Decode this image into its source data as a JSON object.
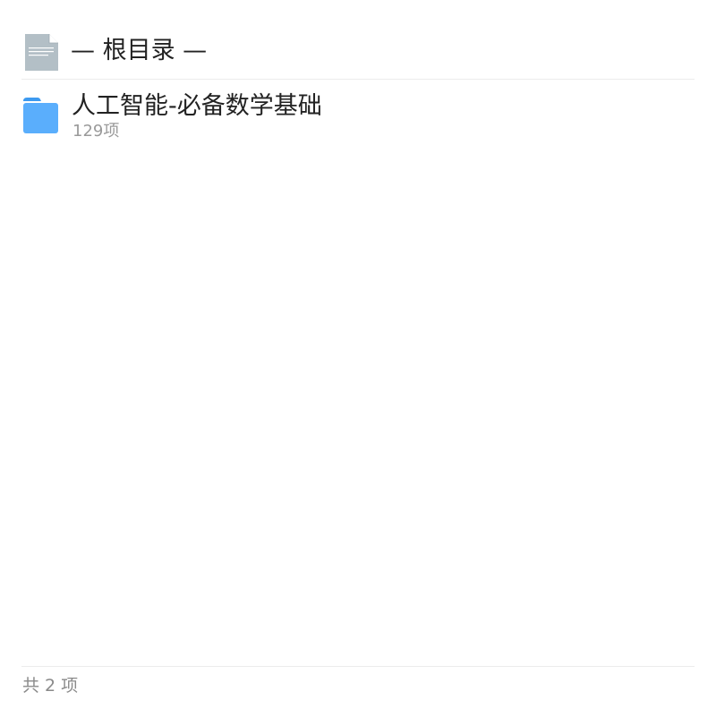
{
  "header": {
    "title": "— 根目录 —",
    "icon": "document-icon"
  },
  "items": [
    {
      "name": "人工智能-必备数学基础",
      "meta": "129项",
      "icon": "folder-icon"
    }
  ],
  "footer": {
    "count": "共 2 项"
  },
  "colors": {
    "folder": "#5aaefc",
    "folder_tab": "#3d9af0",
    "document": "#b3bfc6",
    "divider": "#ececec",
    "secondary_text": "#9a9a9a"
  }
}
